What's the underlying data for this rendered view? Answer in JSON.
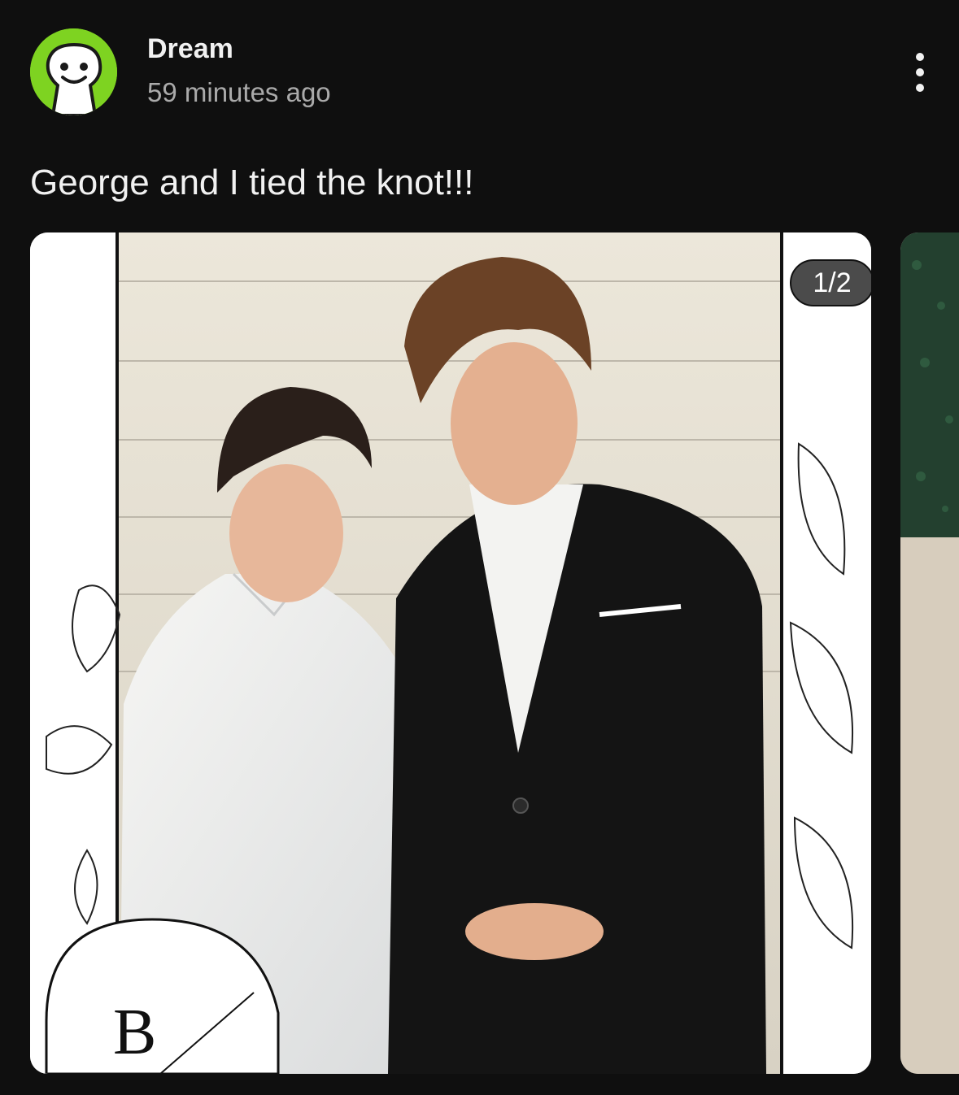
{
  "post": {
    "author": "Dream",
    "timestamp": "59 minutes ago",
    "text": "George and I tied the knot!!!"
  },
  "avatar": {
    "color": "#7ed321",
    "icon": "dream-smiley-mask"
  },
  "more_menu": {
    "icon": "vertical-ellipsis-icon"
  },
  "carousel": {
    "page_indicator": "1/2",
    "current_slide": 1,
    "total_slides": 2,
    "watermark_letter": "B"
  },
  "colors": {
    "background": "#0f0f0f",
    "text_primary": "#f1f1f1",
    "text_secondary": "#aaaaaa",
    "brand_green": "#7ed321"
  }
}
